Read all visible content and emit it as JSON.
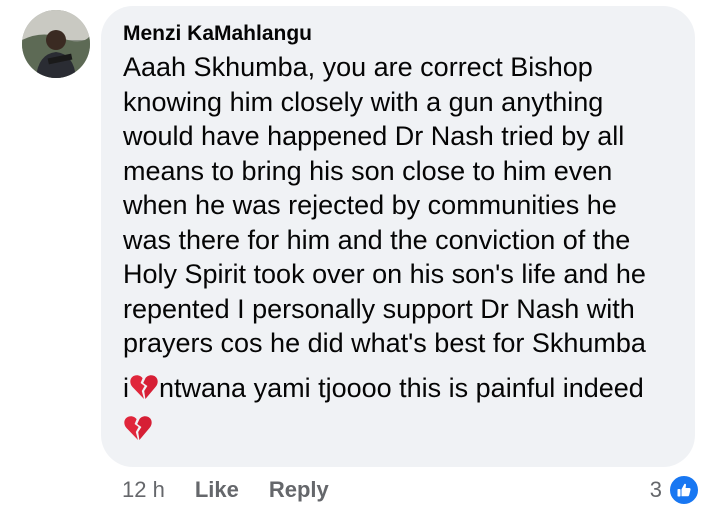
{
  "comment": {
    "author": "Menzi KaMahlangu",
    "body": "Aaah Skhumba, you are correct Bishop\nknowing him closely with a gun anything\nwould have happened Dr Nash tried by all\nmeans to bring his son close to him even\nwhen he was rejected by communities he\nwas there for him and the conviction of the\nHoly Spirit took over on his son's life and he\nrepented I personally support Dr Nash with\nprayers cos he did what's best for Skhumba",
    "second_line_prefix": "i",
    "second_line_text": "ntwana yami tjoooo this is painful indeed",
    "emoji": "broken-heart-icon"
  },
  "actions": {
    "time": "12 h",
    "like_label": "Like",
    "reply_label": "Reply"
  },
  "reactions": {
    "count": "3",
    "icon": "thumbs-up-icon",
    "badge_color": "#1877f2"
  },
  "colors": {
    "bubble": "#f0f2f5",
    "text": "#050505",
    "meta": "#65676b",
    "broken_heart": "#e0263b"
  }
}
